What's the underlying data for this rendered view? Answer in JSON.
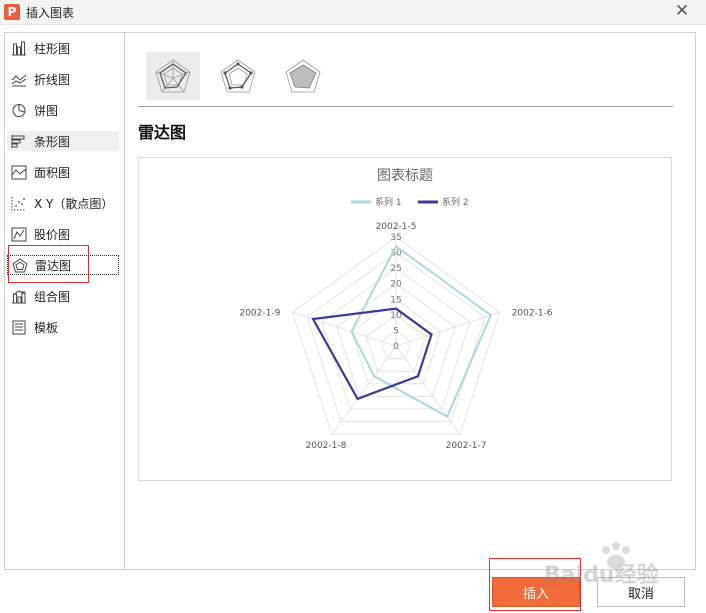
{
  "window": {
    "title": "插入图表",
    "app_icon": "P",
    "close_glyph": "✕"
  },
  "sidebar": {
    "items": [
      {
        "label": "柱形图",
        "icon": "column-chart-icon"
      },
      {
        "label": "折线图",
        "icon": "line-chart-icon"
      },
      {
        "label": "饼图",
        "icon": "pie-chart-icon"
      },
      {
        "label": "条形图",
        "icon": "bar-chart-icon"
      },
      {
        "label": "面积图",
        "icon": "area-chart-icon"
      },
      {
        "label": "X Y（散点图）",
        "icon": "scatter-chart-icon"
      },
      {
        "label": "股价图",
        "icon": "stock-chart-icon"
      },
      {
        "label": "雷达图",
        "icon": "radar-chart-icon"
      },
      {
        "label": "组合图",
        "icon": "combo-chart-icon"
      },
      {
        "label": "模板",
        "icon": "template-icon"
      }
    ],
    "selected_index": 7,
    "hover_index": 3
  },
  "variants": [
    "radar-basic",
    "radar-markers",
    "radar-filled"
  ],
  "selected_variant": 0,
  "main": {
    "section_title": "雷达图"
  },
  "chart_data": {
    "type": "radar",
    "title": "图表标题",
    "categories": [
      "2002-1-5",
      "2002-1-6",
      "2002-1-7",
      "2002-1-8",
      "2002-1-9"
    ],
    "series": [
      {
        "name": "系列 1",
        "values": [
          32,
          32,
          28,
          12,
          15
        ],
        "color": "#a9d9dc"
      },
      {
        "name": "系列 2",
        "values": [
          12,
          12,
          12,
          21,
          28
        ],
        "color": "#3a3a9a"
      }
    ],
    "axis_ticks": [
      0,
      5,
      10,
      15,
      20,
      25,
      30,
      35
    ],
    "rmax": 35,
    "legend_position": "top"
  },
  "buttons": {
    "insert": "插入",
    "cancel": "取消"
  },
  "watermark": {
    "text": "Baidu经验"
  },
  "colors": {
    "accent": "#f06a3a",
    "highlight_box": "#e52b2b"
  }
}
